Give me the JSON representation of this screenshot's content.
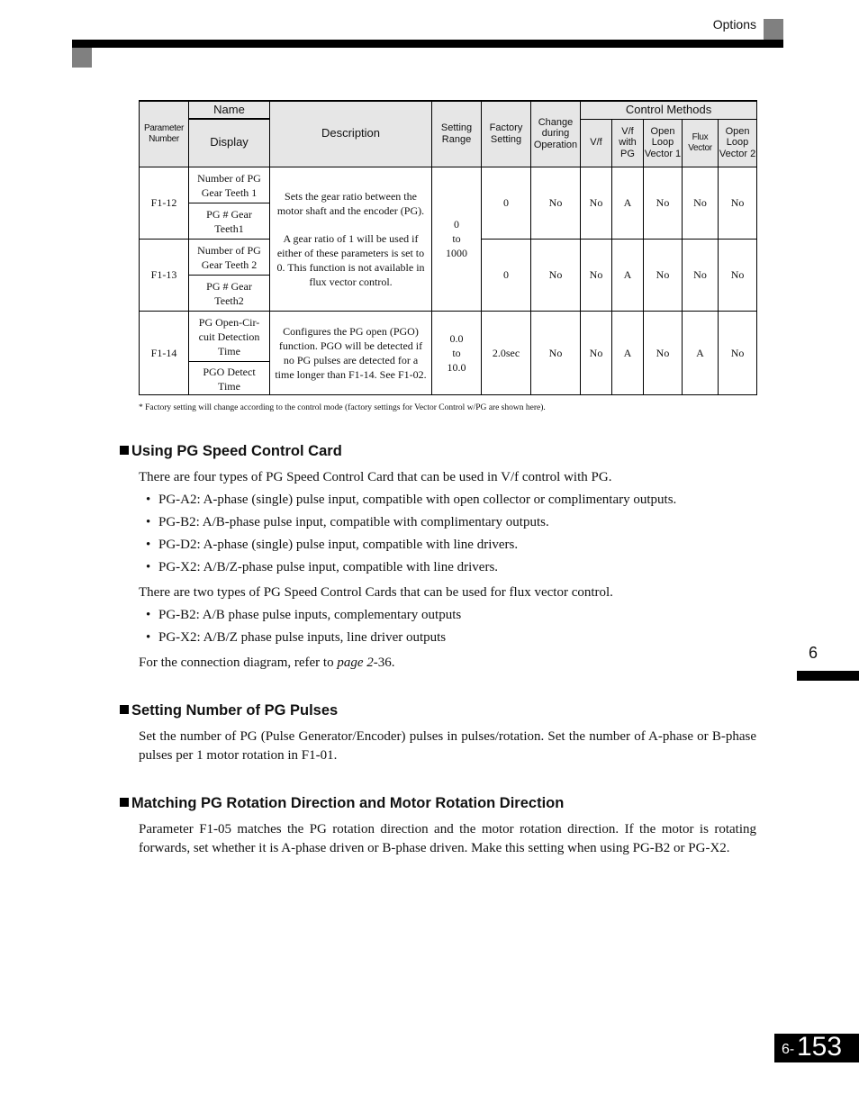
{
  "header": {
    "section_label": "Options"
  },
  "table": {
    "headers": {
      "parameter_number": "Parameter Number",
      "name": "Name",
      "display": "Display",
      "description": "Description",
      "setting_range": "Setting Range",
      "factory_setting": "Factory Setting",
      "change_during_operation": "Change during Operation",
      "control_methods": "Control Methods",
      "methods": [
        "V/f",
        "V/f with PG",
        "Open Loop Vector 1",
        "Flux Vector",
        "Open Loop Vector 2"
      ]
    },
    "rows": [
      {
        "number": "F1-12",
        "name": "Number of PG Gear Teeth 1",
        "display": "PG # Gear Teeth1",
        "factory": "0",
        "change": "No",
        "methods": [
          "No",
          "A",
          "No",
          "No",
          "No"
        ]
      },
      {
        "number": "F1-13",
        "name": "Number of PG Gear Teeth 2",
        "display": "PG # Gear Teeth2",
        "factory": "0",
        "change": "No",
        "methods": [
          "No",
          "A",
          "No",
          "No",
          "No"
        ]
      },
      {
        "number": "F1-14",
        "name": "PG Open-Cir-cuit Detection Time",
        "display": "PGO Detect Time",
        "description": "Configures the PG open (PGO) function. PGO will be detected if no PG pulses are detected for a time longer than F1-14. See F1-02.",
        "range": [
          "0.0",
          "to",
          "10.0"
        ],
        "factory": "2.0sec",
        "change": "No",
        "methods": [
          "No",
          "A",
          "No",
          "A",
          "No"
        ]
      }
    ],
    "shared_description_p1": "Sets the gear ratio between the motor shaft and the encoder (PG).",
    "shared_description_p2": "A gear ratio of 1 will be used if either of these parameters is set to 0. This function is not available in flux vector control.",
    "shared_range": [
      "0",
      "to",
      "1000"
    ],
    "footnote": "*   Factory setting will change according to the control mode (factory settings for Vector Control w/PG are shown here)."
  },
  "sections": [
    {
      "title": "Using PG Speed Control Card",
      "intro": "There are four types of PG Speed Control Card that can be used in V/f control with PG.",
      "bullets": [
        "PG-A2: A-phase (single) pulse input, compatible with open collector or complimentary outputs.",
        "PG-B2: A/B-phase pulse input, compatible with complimentary outputs.",
        "PG-D2: A-phase (single) pulse input, compatible with line drivers.",
        "PG-X2: A/B/Z-phase pulse input, compatible with line drivers."
      ],
      "intro2": "There are two types of PG Speed Control Cards that can be used for flux vector control.",
      "bullets2": [
        "PG-B2: A/B phase pulse inputs, complementary outputs",
        "PG-X2: A/B/Z phase pulse inputs, line driver outputs"
      ],
      "ref_prefix": "For the connection diagram, refer to ",
      "ref_link": "page 2",
      "ref_suffix": "-36."
    },
    {
      "title": "Setting Number of PG Pulses",
      "body": "Set the number of PG (Pulse Generator/Encoder) pulses in pulses/rotation. Set the number of A-phase or B-phase pulses per 1 motor rotation in F1-01."
    },
    {
      "title": "Matching PG Rotation Direction and Motor Rotation Direction",
      "body": "Parameter F1-05 matches the PG rotation direction and the motor rotation direction. If the motor is rotating forwards, set whether it is A-phase driven or B-phase driven. Make this setting when using PG-B2 or PG-X2."
    }
  ],
  "chapter_tab": "6",
  "page_number": {
    "prefix": "6-",
    "number": "153"
  }
}
